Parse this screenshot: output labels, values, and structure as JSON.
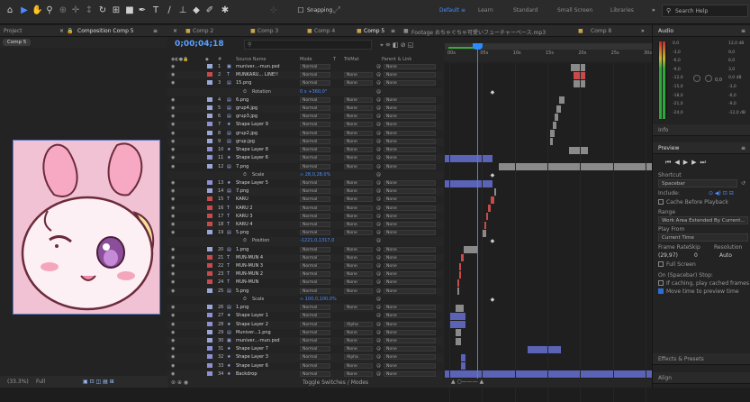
{
  "toolbar": {
    "snapping_label": "Snapping",
    "workspaces": [
      "Default",
      "Learn",
      "Standard",
      "Small Screen",
      "Libraries"
    ],
    "search_placeholder": "Search Help"
  },
  "project_panel": {
    "tab": "Project",
    "comp_tab": "Composition Comp 5",
    "subtab": "Comp 5",
    "zoom": "(33.3%)",
    "quality": "Full"
  },
  "timeline": {
    "tabs": [
      "Comp 2",
      "Comp 3",
      "Comp 4",
      "Comp 5",
      "Footage おちゃぐちゃ可愛いフューチャーベース.mp3",
      "Comp 8"
    ],
    "timecode": "0;00;04;18",
    "search_placeholder": "P​",
    "headers": {
      "num": "#",
      "source": "Source Name",
      "mode": "Mode",
      "t": "T",
      "trkmat": "TrkMat",
      "parent": "Parent & Link"
    },
    "ruler": [
      "00s",
      "05s",
      "10s",
      "15s",
      "20s",
      "25s",
      "30s"
    ],
    "footer": "Toggle Switches / Modes",
    "rows": [
      {
        "type": "layer",
        "num": "1",
        "icon": "psd",
        "name": "muniver...-mun.psd",
        "mode": "Normal",
        "trk": "",
        "parent": "None",
        "color": "#9aa7d6",
        "bar_start": 0.61,
        "bar_end": 0.68,
        "bar_color": "#8a8a8a"
      },
      {
        "type": "layer",
        "num": "2",
        "icon": "text",
        "name": "MUNKARU... LINE!!",
        "mode": "Normal",
        "trk": "None",
        "parent": "None",
        "color": "#c94a4a",
        "bar_start": 0.62,
        "bar_end": 0.68,
        "bar_color": "#c94a4a"
      },
      {
        "type": "layer",
        "num": "3",
        "icon": "png",
        "name": "15.png",
        "mode": "Normal",
        "trk": "None",
        "parent": "None",
        "color": "#9aa7d6",
        "bar_start": 0.62,
        "bar_end": 0.68,
        "bar_color": "#8a8a8a"
      },
      {
        "type": "prop",
        "name": "Rotation",
        "value": "0 x +360,0°"
      },
      {
        "type": "layer",
        "num": "4",
        "icon": "png",
        "name": "6.png",
        "mode": "Normal",
        "trk": "None",
        "parent": "None",
        "color": "#9aa7d6",
        "bar_start": 0.55,
        "bar_end": 0.58,
        "bar_color": "#8a8a8a"
      },
      {
        "type": "layer",
        "num": "5",
        "icon": "png",
        "name": "grup4.jpg",
        "mode": "Normal",
        "trk": "None",
        "parent": "None",
        "color": "#9aa7d6",
        "bar_start": 0.54,
        "bar_end": 0.56,
        "bar_color": "#8a8a8a"
      },
      {
        "type": "layer",
        "num": "6",
        "icon": "png",
        "name": "grup3.jpg",
        "mode": "Normal",
        "trk": "None",
        "parent": "None",
        "color": "#9aa7d6",
        "bar_start": 0.53,
        "bar_end": 0.55,
        "bar_color": "#8a8a8a"
      },
      {
        "type": "layer",
        "num": "7",
        "icon": "star",
        "name": "Shape Layer 9",
        "mode": "Normal",
        "trk": "None",
        "parent": "None",
        "color": "#8f8fd6",
        "bar_start": 0.52,
        "bar_end": 0.54,
        "bar_color": "#8a8a8a"
      },
      {
        "type": "layer",
        "num": "8",
        "icon": "png",
        "name": "grup2.jpg",
        "mode": "Normal",
        "trk": "None",
        "parent": "None",
        "color": "#9aa7d6",
        "bar_start": 0.51,
        "bar_end": 0.53,
        "bar_color": "#8a8a8a"
      },
      {
        "type": "layer",
        "num": "9",
        "icon": "png",
        "name": "grup.jpg",
        "mode": "Normal",
        "trk": "None",
        "parent": "None",
        "color": "#9aa7d6",
        "bar_start": 0.51,
        "bar_end": 0.52,
        "bar_color": "#8a8a8a"
      },
      {
        "type": "layer",
        "num": "10",
        "icon": "star",
        "name": "Shape Layer 8",
        "mode": "Normal",
        "trk": "None",
        "parent": "None",
        "color": "#8f8fd6",
        "bar_start": 0.6,
        "bar_end": 0.69,
        "bar_color": "#8a8a8a"
      },
      {
        "type": "layer",
        "num": "11",
        "icon": "star",
        "name": "Shape Layer 6",
        "mode": "Normal",
        "trk": "None",
        "parent": "None",
        "color": "#8f8fd6",
        "bar_start": 0.0,
        "bar_end": 0.23,
        "bar_color": "#5b63b7"
      },
      {
        "type": "layer",
        "num": "12",
        "icon": "png",
        "name": "7.png",
        "mode": "Normal",
        "trk": "None",
        "parent": "None",
        "color": "#9aa7d6",
        "bar_start": 0.26,
        "bar_end": 1.0,
        "bar_color": "#8a8a8a"
      },
      {
        "type": "prop",
        "name": "Scale",
        "value": "∞ 28,0,28,0%"
      },
      {
        "type": "layer",
        "num": "13",
        "icon": "star",
        "name": "Shape Layer 5",
        "mode": "Normal",
        "trk": "None",
        "parent": "None",
        "color": "#8f8fd6",
        "bar_start": 0.0,
        "bar_end": 0.23,
        "bar_color": "#5b63b7"
      },
      {
        "type": "layer",
        "num": "14",
        "icon": "png",
        "name": "7.png",
        "mode": "Normal",
        "trk": "None",
        "parent": "None",
        "color": "#9aa7d6",
        "bar_start": 0.24,
        "bar_end": 0.25,
        "bar_color": "#8a8a8a"
      },
      {
        "type": "layer",
        "num": "15",
        "icon": "text",
        "name": "KARU",
        "mode": "Normal",
        "trk": "None",
        "parent": "None",
        "color": "#c94a4a",
        "bar_start": 0.22,
        "bar_end": 0.24,
        "bar_color": "#c94a4a"
      },
      {
        "type": "layer",
        "num": "16",
        "icon": "text",
        "name": "KARU 2",
        "mode": "Normal",
        "trk": "None",
        "parent": "None",
        "color": "#c94a4a",
        "bar_start": 0.21,
        "bar_end": 0.22,
        "bar_color": "#c94a4a"
      },
      {
        "type": "layer",
        "num": "17",
        "icon": "text",
        "name": "KARU 3",
        "mode": "Normal",
        "trk": "None",
        "parent": "None",
        "color": "#c94a4a",
        "bar_start": 0.2,
        "bar_end": 0.21,
        "bar_color": "#c94a4a"
      },
      {
        "type": "layer",
        "num": "18",
        "icon": "text",
        "name": "KARU 4",
        "mode": "Normal",
        "trk": "None",
        "parent": "None",
        "color": "#c94a4a",
        "bar_start": 0.19,
        "bar_end": 0.2,
        "bar_color": "#c94a4a"
      },
      {
        "type": "layer",
        "num": "19",
        "icon": "png",
        "name": "5.png",
        "mode": "Normal",
        "trk": "None",
        "parent": "None",
        "color": "#9aa7d6",
        "bar_start": 0.18,
        "bar_end": 0.2,
        "bar_color": "#8a8a8a"
      },
      {
        "type": "prop",
        "name": "Position",
        "value": "-1221,0,1317,0"
      },
      {
        "type": "layer",
        "num": "20",
        "icon": "png",
        "name": "1.png",
        "mode": "Normal",
        "trk": "None",
        "parent": "None",
        "color": "#9aa7d6",
        "bar_start": 0.09,
        "bar_end": 0.16,
        "bar_color": "#8a8a8a"
      },
      {
        "type": "layer",
        "num": "21",
        "icon": "text",
        "name": "MUN-MUN 4",
        "mode": "Normal",
        "trk": "None",
        "parent": "None",
        "color": "#c94a4a",
        "bar_start": 0.08,
        "bar_end": 0.09,
        "bar_color": "#c94a4a"
      },
      {
        "type": "layer",
        "num": "22",
        "icon": "text",
        "name": "MUN-MUN 3",
        "mode": "Normal",
        "trk": "None",
        "parent": "None",
        "color": "#c94a4a",
        "bar_start": 0.07,
        "bar_end": 0.08,
        "bar_color": "#c94a4a"
      },
      {
        "type": "layer",
        "num": "23",
        "icon": "text",
        "name": "MUN-MUN 2",
        "mode": "Normal",
        "trk": "None",
        "parent": "None",
        "color": "#c94a4a",
        "bar_start": 0.07,
        "bar_end": 0.08,
        "bar_color": "#c94a4a"
      },
      {
        "type": "layer",
        "num": "24",
        "icon": "text",
        "name": "MUN-MUN",
        "mode": "Normal",
        "trk": "None",
        "parent": "None",
        "color": "#c94a4a",
        "bar_start": 0.06,
        "bar_end": 0.07,
        "bar_color": "#c94a4a"
      },
      {
        "type": "layer",
        "num": "25",
        "icon": "png",
        "name": "5.png",
        "mode": "Normal",
        "trk": "None",
        "parent": "None",
        "color": "#9aa7d6",
        "bar_start": 0.06,
        "bar_end": 0.07,
        "bar_color": "#8a8a8a"
      },
      {
        "type": "prop",
        "name": "Scale",
        "value": "∞ 100,0,100,0%"
      },
      {
        "type": "layer",
        "num": "26",
        "icon": "png",
        "name": "1.png",
        "mode": "Normal",
        "trk": "None",
        "parent": "None",
        "color": "#9aa7d6",
        "bar_start": 0.05,
        "bar_end": 0.09,
        "bar_color": "#8a8a8a"
      },
      {
        "type": "layer",
        "num": "27",
        "icon": "star",
        "name": "Shape Layer 1",
        "mode": "Normal",
        "trk": "",
        "parent": "None",
        "color": "#8f8fd6",
        "bar_start": 0.02,
        "bar_end": 0.1,
        "bar_color": "#5b63b7"
      },
      {
        "type": "layer",
        "num": "28",
        "icon": "star",
        "name": "Shape Layer 2",
        "mode": "Normal",
        "trk": "Alpha",
        "parent": "None",
        "color": "#8f8fd6",
        "bar_start": 0.02,
        "bar_end": 0.1,
        "bar_color": "#5b63b7"
      },
      {
        "type": "layer",
        "num": "29",
        "icon": "png",
        "name": "Muniver...1.png",
        "mode": "Normal",
        "trk": "None",
        "parent": "None",
        "color": "#9aa7d6",
        "bar_start": 0.05,
        "bar_end": 0.08,
        "bar_color": "#8a8a8a"
      },
      {
        "type": "layer",
        "num": "30",
        "icon": "psd",
        "name": "muniver...-mun.psd",
        "mode": "Normal",
        "trk": "None",
        "parent": "None",
        "color": "#9aa7d6",
        "bar_start": 0.05,
        "bar_end": 0.08,
        "bar_color": "#8a8a8a"
      },
      {
        "type": "layer",
        "num": "31",
        "icon": "star",
        "name": "Shape Layer 7",
        "mode": "Normal",
        "trk": "None",
        "parent": "None",
        "color": "#8f8fd6",
        "bar_start": 0.4,
        "bar_end": 0.56,
        "bar_color": "#5b63b7"
      },
      {
        "type": "layer",
        "num": "32",
        "icon": "star",
        "name": "Shape Layer 3",
        "mode": "Normal",
        "trk": "Alpha",
        "parent": "None",
        "color": "#8f8fd6",
        "bar_start": 0.08,
        "bar_end": 0.1,
        "bar_color": "#5b63b7"
      },
      {
        "type": "layer",
        "num": "33",
        "icon": "star",
        "name": "Shape Layer 6",
        "mode": "Normal",
        "trk": "None",
        "parent": "None",
        "color": "#8f8fd6",
        "bar_start": 0.08,
        "bar_end": 0.1,
        "bar_color": "#5b63b7"
      },
      {
        "type": "layer",
        "num": "34",
        "icon": "star",
        "name": "Backdrop",
        "mode": "Normal",
        "trk": "None",
        "parent": "None",
        "color": "#8f8fd6",
        "bar_start": 0.0,
        "bar_end": 1.0,
        "bar_color": "#5b63b7"
      }
    ]
  },
  "audio": {
    "title": "Audio",
    "left_scale": [
      "0,0",
      "-3,0",
      "-6,0",
      "-9,0",
      "-12,0",
      "-15,0",
      "-18,0",
      "-21,0",
      "-24,0"
    ],
    "right_scale": [
      "12,0 dB",
      "9,0",
      "6,0",
      "3,0",
      "0,0 dB",
      "-3,0",
      "-6,0",
      "-9,0",
      "-12,0 dB"
    ],
    "right_meter_label": "0,0"
  },
  "info": {
    "title": "Info"
  },
  "preview": {
    "title": "Preview",
    "shortcut_label": "Shortcut",
    "shortcut_value": "Spacebar",
    "include_label": "Include:",
    "cache_label": "Cache Before Playback",
    "range_label": "Range",
    "range_value": "Work Area Extended By Current...",
    "play_from_label": "Play From",
    "play_from_value": "Current Time",
    "frame_rate_label": "Frame Rate",
    "skip_label": "Skip",
    "resolution_label": "Resolution",
    "frame_rate_value": "(29,97)",
    "skip_value": "0",
    "resolution_value": "Auto",
    "full_screen_label": "Full Screen",
    "stop_label": "On (Spacebar) Stop:",
    "if_caching_label": "If caching, play cached frames",
    "move_time_label": "Move time to preview time"
  },
  "effects": {
    "title": "Effects & Presets"
  },
  "align": {
    "title": "Align"
  },
  "colors": {
    "accent": "#2b6fd6",
    "playhead": "#2b8cff"
  }
}
